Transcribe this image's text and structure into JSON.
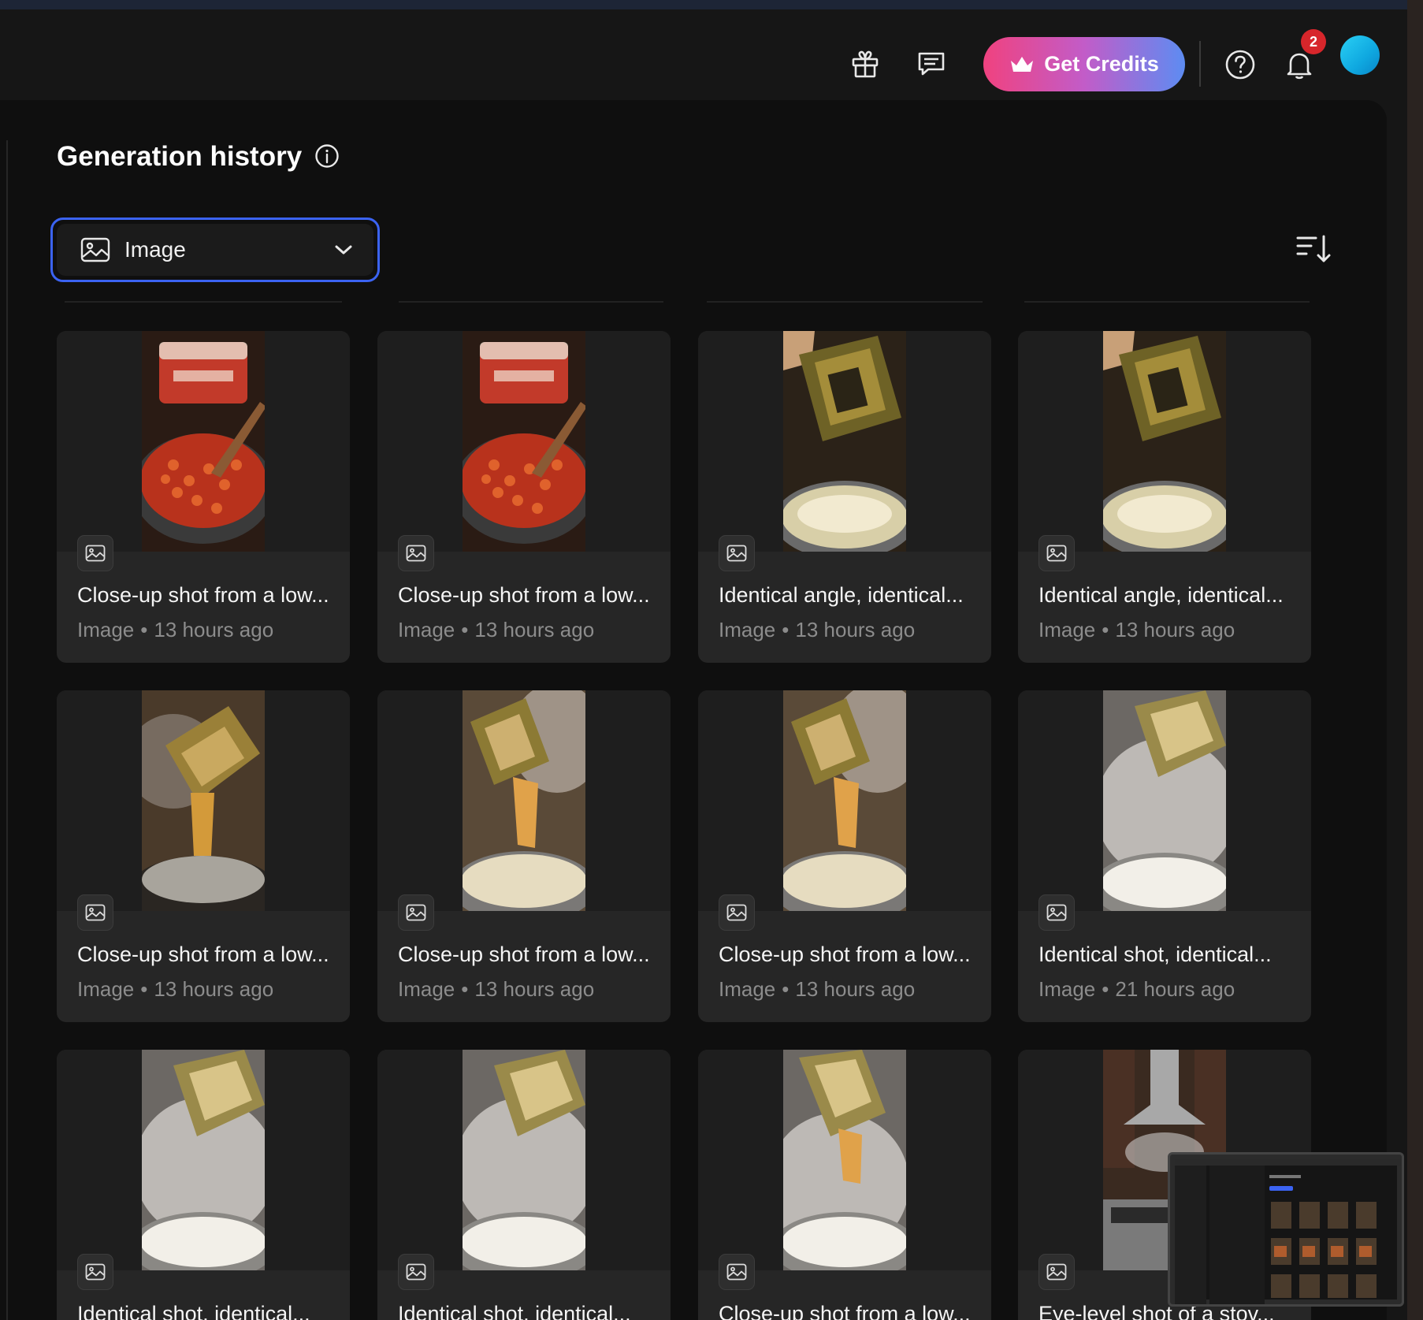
{
  "header": {
    "gift_icon": "gift-icon",
    "feedback_icon": "chat-feedback-icon",
    "credits_label": "Get Credits",
    "credits_icon": "crown-icon",
    "help_icon": "help-icon",
    "notifications_icon": "bell-icon",
    "notification_count": "2",
    "avatar_color": "#19b8ec"
  },
  "page": {
    "title": "Generation history",
    "info_icon": "info-icon"
  },
  "filter": {
    "selected": "Image",
    "icon": "image-icon",
    "dropdown_icon": "chevron-down-icon",
    "accent_color": "#3b63f2"
  },
  "sort": {
    "icon": "sort-descending-icon"
  },
  "cards": [
    {
      "title": "Close-up shot from a low...",
      "type": "Image",
      "age": "13 hours ago",
      "scene": "sauce"
    },
    {
      "title": "Close-up shot from a low...",
      "type": "Image",
      "age": "13 hours ago",
      "scene": "sauce"
    },
    {
      "title": "Identical angle, identical...",
      "type": "Image",
      "age": "13 hours ago",
      "scene": "box-boil"
    },
    {
      "title": "Identical angle, identical...",
      "type": "Image",
      "age": "13 hours ago",
      "scene": "box-boil"
    },
    {
      "title": "Close-up shot from a low...",
      "type": "Image",
      "age": "13 hours ago",
      "scene": "pour-dark"
    },
    {
      "title": "Close-up shot from a low...",
      "type": "Image",
      "age": "13 hours ago",
      "scene": "pour"
    },
    {
      "title": "Close-up shot from a low...",
      "type": "Image",
      "age": "13 hours ago",
      "scene": "pour"
    },
    {
      "title": "Identical shot, identical...",
      "type": "Image",
      "age": "21 hours ago",
      "scene": "steam"
    },
    {
      "title": "Identical shot, identical...",
      "type": "Image",
      "age": "",
      "scene": "steam"
    },
    {
      "title": "Identical shot, identical...",
      "type": "Image",
      "age": "",
      "scene": "steam"
    },
    {
      "title": "Close-up shot from a low...",
      "type": "Image",
      "age": "",
      "scene": "steam-pour"
    },
    {
      "title": "Eye-level shot of a stov...",
      "type": "Image",
      "age": "",
      "scene": "kitchen"
    }
  ],
  "meta_separator": "•"
}
